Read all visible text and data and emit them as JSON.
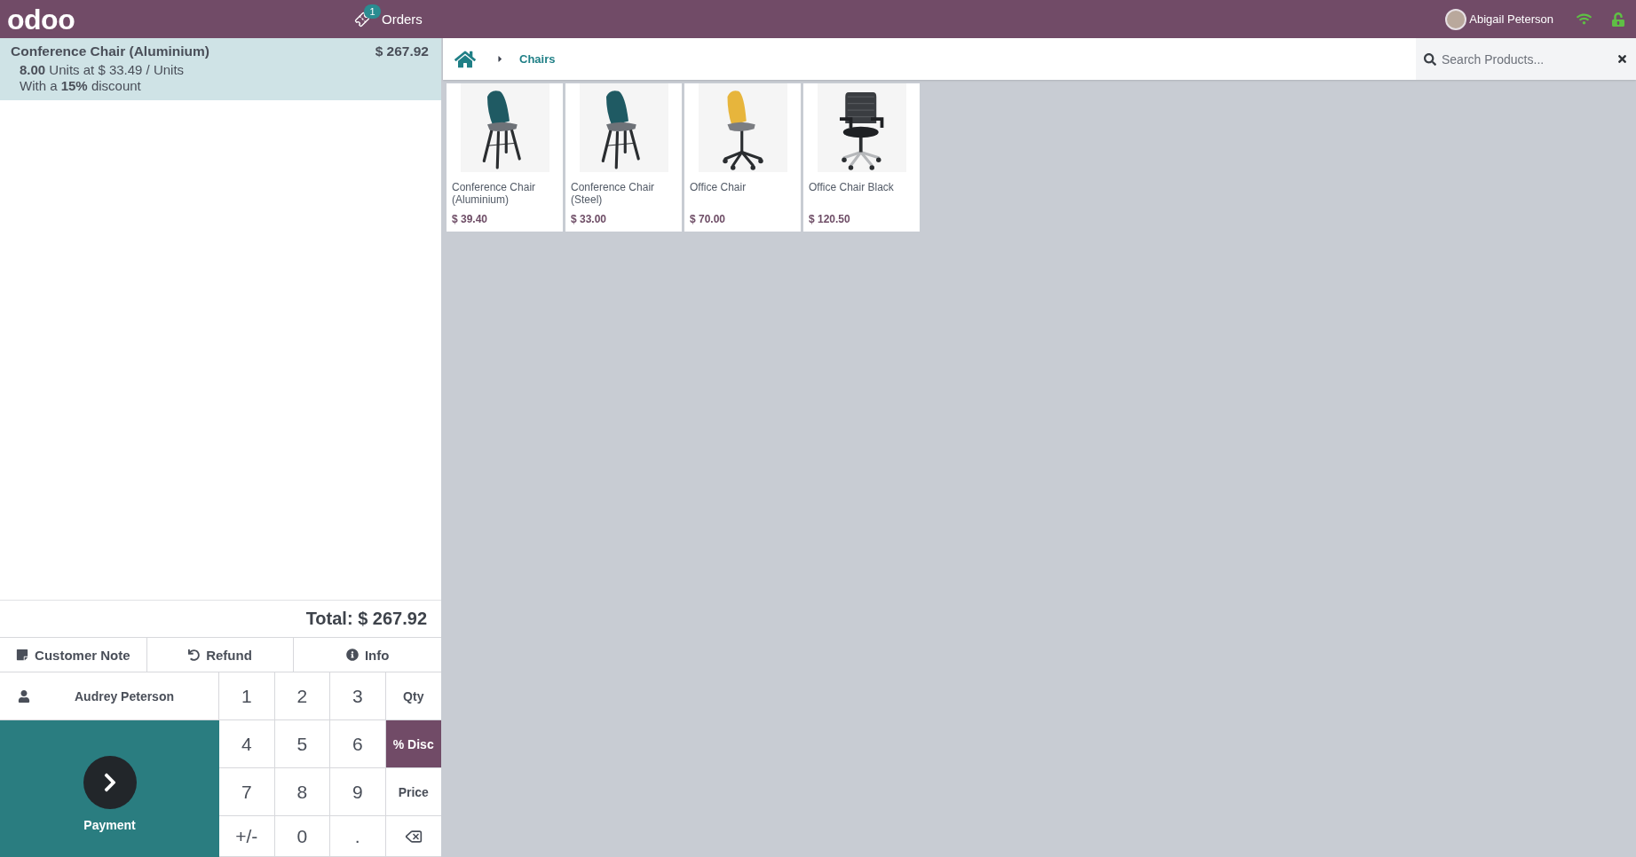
{
  "header": {
    "logo": "odoo",
    "orders": {
      "label": "Orders",
      "count": "1"
    },
    "user": {
      "name": "Abigail Peterson"
    }
  },
  "order_lines": [
    {
      "product": "Conference Chair (Aluminium)",
      "price": "$ 267.92",
      "details": [
        "**8.00** Units at $ 33.49 / Units",
        "With a **15%** discount"
      ],
      "selected": true
    }
  ],
  "total": "Total: $ 267.92",
  "control_buttons": [
    {
      "kind": "note",
      "label": "Customer Note"
    },
    {
      "kind": "refund",
      "label": "Refund"
    },
    {
      "kind": "info",
      "label": "Info"
    }
  ],
  "customer": {
    "name": "Audrey Peterson"
  },
  "payment": {
    "label": "Payment"
  },
  "numpad": {
    "keys": [
      {
        "kind": "digit",
        "label": "1"
      },
      {
        "kind": "digit",
        "label": "2"
      },
      {
        "kind": "digit",
        "label": "3"
      },
      {
        "kind": "mode",
        "label": "Qty",
        "selected": false
      },
      {
        "kind": "digit",
        "label": "4"
      },
      {
        "kind": "digit",
        "label": "5"
      },
      {
        "kind": "digit",
        "label": "6"
      },
      {
        "kind": "mode",
        "label": "% Disc",
        "selected": true
      },
      {
        "kind": "digit",
        "label": "7"
      },
      {
        "kind": "digit",
        "label": "8"
      },
      {
        "kind": "digit",
        "label": "9"
      },
      {
        "kind": "mode",
        "label": "Price",
        "selected": false
      },
      {
        "kind": "digit",
        "label": "+/-"
      },
      {
        "kind": "digit",
        "label": "0"
      },
      {
        "kind": "digit",
        "label": "."
      },
      {
        "kind": "backspace"
      }
    ]
  },
  "breadcrumb": {
    "items": [
      "Chairs"
    ]
  },
  "search": {
    "placeholder": "Search Products..."
  },
  "products": [
    {
      "name": "Conference Chair (Aluminium)",
      "price": "$ 39.40",
      "kind": "shell"
    },
    {
      "name": "Conference Chair (Steel)",
      "price": "$ 33.00",
      "kind": "shell"
    },
    {
      "name": "Office Chair",
      "price": "$ 70.00",
      "kind": "swivel"
    },
    {
      "name": "Office Chair Black",
      "price": "$ 120.50",
      "kind": "mesh"
    }
  ]
}
